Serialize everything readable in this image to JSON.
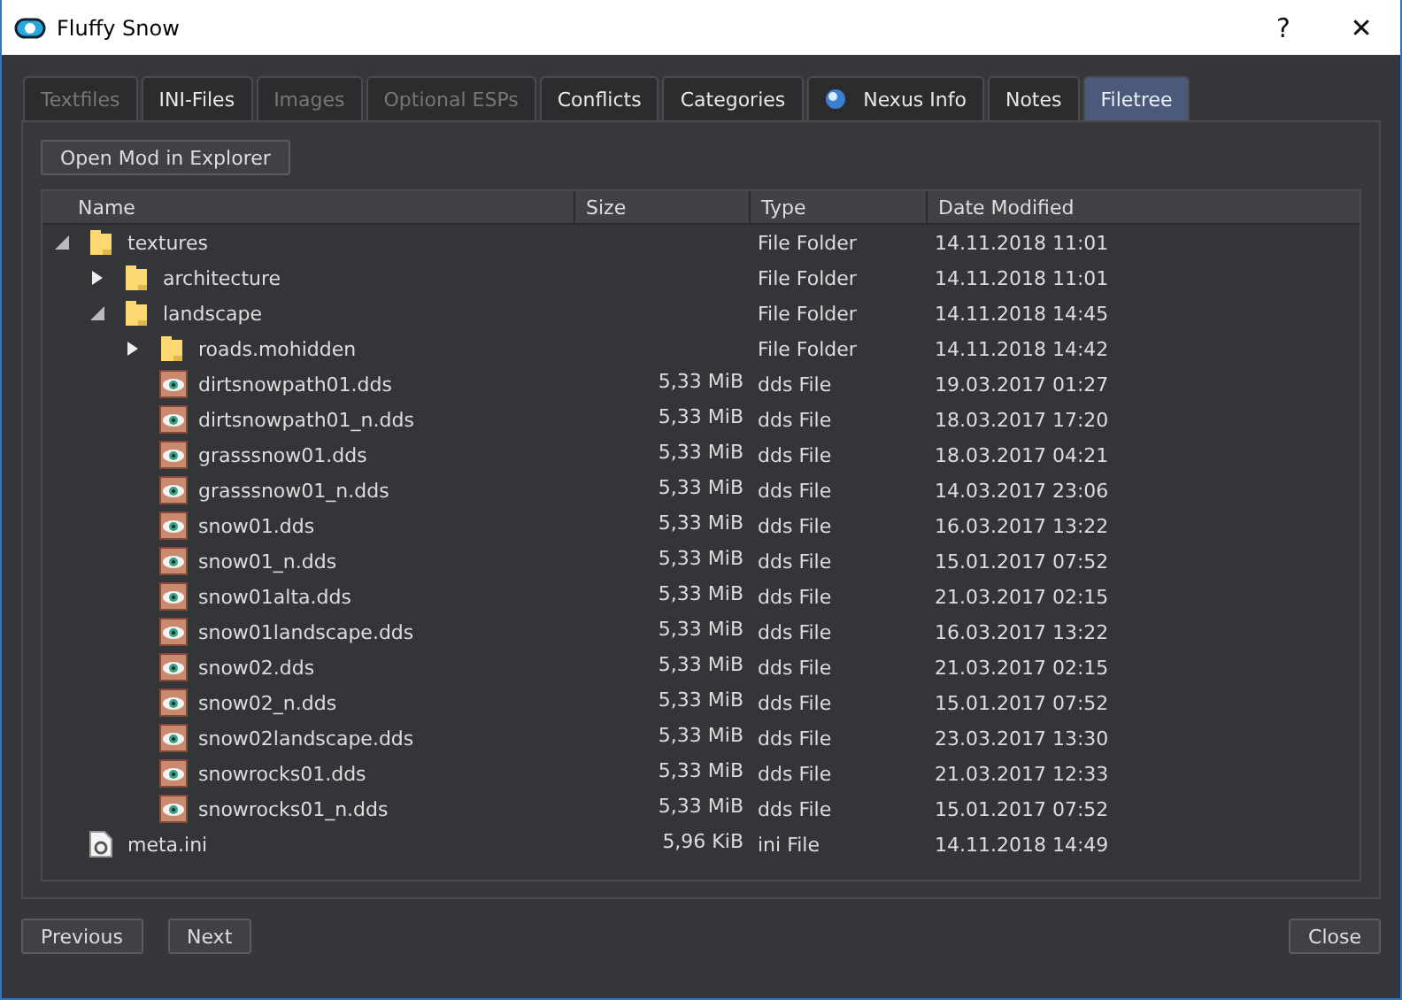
{
  "window": {
    "title": "Fluffy Snow",
    "help": "?",
    "close": "✕"
  },
  "tabs": [
    {
      "label": "Textfiles",
      "selected": false,
      "disabled": true
    },
    {
      "label": "INI-Files",
      "selected": false,
      "disabled": false
    },
    {
      "label": "Images",
      "selected": false,
      "disabled": true
    },
    {
      "label": "Optional ESPs",
      "selected": false,
      "disabled": true
    },
    {
      "label": "Conflicts",
      "selected": false,
      "disabled": false
    },
    {
      "label": "Categories",
      "selected": false,
      "disabled": false
    },
    {
      "label": "Nexus Info",
      "selected": false,
      "disabled": false,
      "kind": "globe"
    },
    {
      "label": "Notes",
      "selected": false,
      "disabled": false
    },
    {
      "label": "Filetree",
      "selected": true,
      "disabled": false
    }
  ],
  "open_button": "Open Mod in Explorer",
  "tree": {
    "columns": [
      "Name",
      "Size",
      "Type",
      "Date Modified"
    ],
    "rows": [
      {
        "kind": "folder",
        "name": "textures",
        "type": "File Folder",
        "date": "14.11.2018 11:01",
        "expanded": true,
        "children": [
          {
            "kind": "folder",
            "name": "architecture",
            "type": "File Folder",
            "date": "14.11.2018 11:01",
            "expanded": false
          },
          {
            "kind": "folder",
            "name": "landscape",
            "type": "File Folder",
            "date": "14.11.2018 14:45",
            "expanded": true,
            "children": [
              {
                "kind": "folder",
                "name": "roads.mohidden",
                "type": "File Folder",
                "date": "14.11.2018 14:42",
                "expanded": false
              },
              {
                "kind": "dds",
                "name": "dirtsnowpath01.dds",
                "size": "5,33 MiB",
                "type": "dds File",
                "date": "19.03.2017 01:27"
              },
              {
                "kind": "dds",
                "name": "dirtsnowpath01_n.dds",
                "size": "5,33 MiB",
                "type": "dds File",
                "date": "18.03.2017 17:20"
              },
              {
                "kind": "dds",
                "name": "grasssnow01.dds",
                "size": "5,33 MiB",
                "type": "dds File",
                "date": "18.03.2017 04:21"
              },
              {
                "kind": "dds",
                "name": "grasssnow01_n.dds",
                "size": "5,33 MiB",
                "type": "dds File",
                "date": "14.03.2017 23:06"
              },
              {
                "kind": "dds",
                "name": "snow01.dds",
                "size": "5,33 MiB",
                "type": "dds File",
                "date": "16.03.2017 13:22"
              },
              {
                "kind": "dds",
                "name": "snow01_n.dds",
                "size": "5,33 MiB",
                "type": "dds File",
                "date": "15.01.2017 07:52"
              },
              {
                "kind": "dds",
                "name": "snow01alta.dds",
                "size": "5,33 MiB",
                "type": "dds File",
                "date": "21.03.2017 02:15"
              },
              {
                "kind": "dds",
                "name": "snow01landscape.dds",
                "size": "5,33 MiB",
                "type": "dds File",
                "date": "16.03.2017 13:22"
              },
              {
                "kind": "dds",
                "name": "snow02.dds",
                "size": "5,33 MiB",
                "type": "dds File",
                "date": "21.03.2017 02:15"
              },
              {
                "kind": "dds",
                "name": "snow02_n.dds",
                "size": "5,33 MiB",
                "type": "dds File",
                "date": "15.01.2017 07:52"
              },
              {
                "kind": "dds",
                "name": "snow02landscape.dds",
                "size": "5,33 MiB",
                "type": "dds File",
                "date": "23.03.2017 13:30"
              },
              {
                "kind": "dds",
                "name": "snowrocks01.dds",
                "size": "5,33 MiB",
                "type": "dds File",
                "date": "21.03.2017 12:33"
              },
              {
                "kind": "dds",
                "name": "snowrocks01_n.dds",
                "size": "5,33 MiB",
                "type": "dds File",
                "date": "15.01.2017 07:52"
              }
            ]
          }
        ]
      },
      {
        "kind": "ini",
        "name": "meta.ini",
        "size": "5,96 KiB",
        "type": "ini File",
        "date": "14.11.2018 14:49"
      }
    ]
  },
  "footer": {
    "previous": "Previous",
    "next": "Next",
    "close": "Close"
  }
}
